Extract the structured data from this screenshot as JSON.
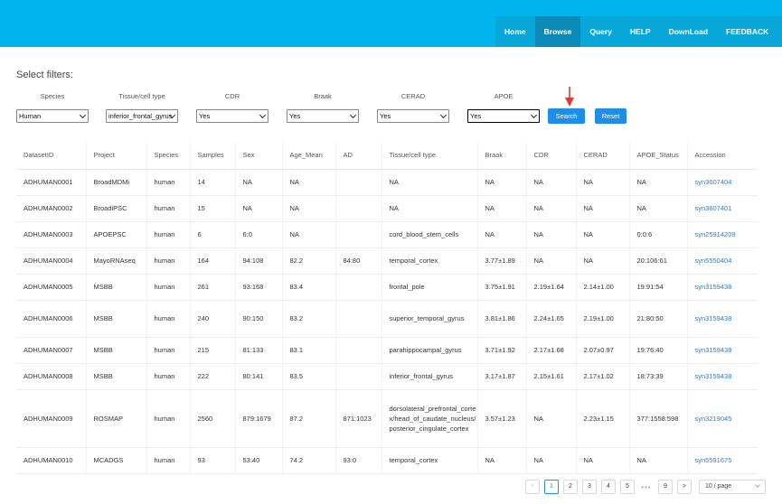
{
  "nav": [
    {
      "label": "Home"
    },
    {
      "label": "Browse",
      "active": true
    },
    {
      "label": "Query"
    },
    {
      "label": "HELP"
    },
    {
      "label": "DownLoad"
    },
    {
      "label": "FEEDBACK"
    }
  ],
  "filters_title": "Select filters:",
  "filters": [
    {
      "label": "Species",
      "value": "Human"
    },
    {
      "label": "Tissue/cell type",
      "value": "inferior_frontal_gyrus"
    },
    {
      "label": "CDR",
      "value": "Yes"
    },
    {
      "label": "Braak",
      "value": "Yes"
    },
    {
      "label": "CERAD",
      "value": "Yes"
    },
    {
      "label": "APOE",
      "value": "Yes"
    }
  ],
  "buttons": {
    "search": "Search",
    "reset": "Reset"
  },
  "table": {
    "headers": [
      "DatasetID",
      "Project",
      "Species",
      "Samples",
      "Sex",
      "Age_Mean",
      "AD",
      "Tissue/cell type",
      "Braak",
      "CDR",
      "CERAD",
      "APOE_Status",
      "Accession"
    ],
    "rows": [
      [
        "ADHUMAN0001",
        "BroadMDMi",
        "human",
        "14",
        "NA",
        "NA",
        "",
        "NA",
        "NA",
        "NA",
        "NA",
        "NA",
        "syn3607404"
      ],
      [
        "ADHUMAN0002",
        "BroadiPSC",
        "human",
        "15",
        "NA",
        "NA",
        "",
        "NA",
        "NA",
        "NA",
        "NA",
        "NA",
        "syn3607401"
      ],
      [
        "ADHUMAN0003",
        "APOEPSC",
        "human",
        "6",
        "6:0",
        "NA",
        "",
        "cord_blood_stem_cells",
        "NA",
        "NA",
        "NA",
        "0:0:6",
        "syn25914209"
      ],
      [
        "ADHUMAN0004",
        "MayoRNAseq",
        "human",
        "164",
        "94:108",
        "82.2",
        "84:80",
        "temporal_cortex",
        "3.77±1.89",
        "NA",
        "NA",
        "20:106:61",
        "syn5550404"
      ],
      [
        "ADHUMAN0005",
        "MSBB",
        "human",
        "261",
        "93:168",
        "83.4",
        "",
        "frontal_pole",
        "3.75±1.91",
        "2.19±1.64",
        "2.14±1.00",
        "19:91:54",
        "syn3159438"
      ],
      [
        "ADHUMAN0006",
        "MSBB",
        "human",
        "240",
        "90:150",
        "83.2",
        "",
        "superior_temporal_gyrus",
        "3.81±1.86",
        "2.24±1.65",
        "2.19±1.00",
        "21:80:50",
        "syn3159438"
      ],
      [
        "ADHUMAN0007",
        "MSBB",
        "human",
        "215",
        "81:133",
        "83.1",
        "",
        "parahippocampal_gyrus",
        "3.71±1.92",
        "2.17±1.68",
        "2.07±0.97",
        "19:76:40",
        "syn3159438"
      ],
      [
        "ADHUMAN0008",
        "MSBB",
        "human",
        "222",
        "80:141",
        "83.5",
        "",
        "inferior_frontal_gyrus",
        "3.17±1.87",
        "2.15±1.61",
        "2.17±1.02",
        "18:73:39",
        "syn3159438"
      ],
      [
        "ADHUMAN0009",
        "ROSMAP",
        "human",
        "2560",
        "879:1679",
        "87.2",
        "871:1023",
        "dorsolateral_prefrontal_cortex/head_of_caudate_nucleus/posterior_cingulate_cortex",
        "3.57±1.23",
        "NA",
        "2.23±1.15",
        "377:1558:598",
        "syn3219045"
      ],
      [
        "ADHUMAN0010",
        "MCADGS",
        "human",
        "93",
        "53:40",
        "74.2",
        "93:0",
        "temporal_cortex",
        "NA",
        "NA",
        "NA",
        "NA",
        "syn5591675"
      ]
    ]
  },
  "pagination": {
    "prev": "<",
    "pages": [
      "1",
      "2",
      "3",
      "4",
      "5"
    ],
    "ellipsis": "•••",
    "last": "9",
    "next": ">",
    "active_page": "1",
    "page_size": "10 / page"
  },
  "colors": {
    "topbar": "#00b5ec",
    "nav_active": "#0b89b7",
    "button": "#1e8ee8",
    "link": "#1e7ed8",
    "arrow": "#e53935"
  }
}
